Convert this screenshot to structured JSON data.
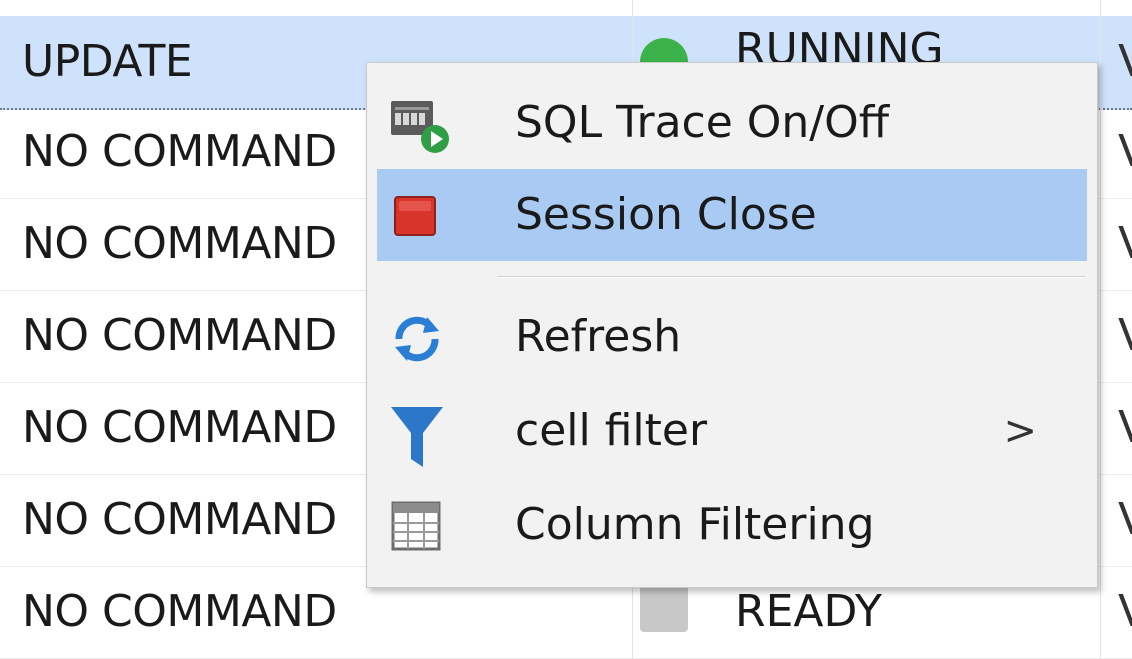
{
  "grid": {
    "rows": [
      {
        "command": "",
        "status": "",
        "edge": ""
      },
      {
        "command": "UPDATE",
        "status": "RUNNING",
        "status_color": "#3cb34a",
        "edge": "V"
      },
      {
        "command": "NO COMMAND",
        "status": "",
        "edge": "V"
      },
      {
        "command": "NO COMMAND",
        "status": "",
        "edge": "V"
      },
      {
        "command": "NO COMMAND",
        "status": "",
        "edge": "V"
      },
      {
        "command": "NO COMMAND",
        "status": "",
        "edge": "V"
      },
      {
        "command": "NO COMMAND",
        "status": "",
        "edge": "V"
      },
      {
        "command": "NO COMMAND",
        "status": "READY",
        "status_color": "#c8c8c8",
        "edge": "V"
      }
    ]
  },
  "context_menu": {
    "items": [
      {
        "label": "SQL Trace On/Off",
        "icon": "sql-trace-icon"
      },
      {
        "label": "Session Close",
        "icon": "stop-icon",
        "highlighted": true
      },
      {
        "label": "Refresh",
        "icon": "refresh-icon"
      },
      {
        "label": "cell filter",
        "icon": "funnel-icon",
        "submenu_arrow": ">"
      },
      {
        "label": "Column Filtering",
        "icon": "table-grid-icon"
      }
    ]
  },
  "colors": {
    "selection_row": "#cfe2fb",
    "menu_highlight": "#a9cbf3",
    "stop_red": "#d9342b",
    "refresh_blue": "#2a7fd4",
    "filter_blue": "#2d77c9"
  }
}
